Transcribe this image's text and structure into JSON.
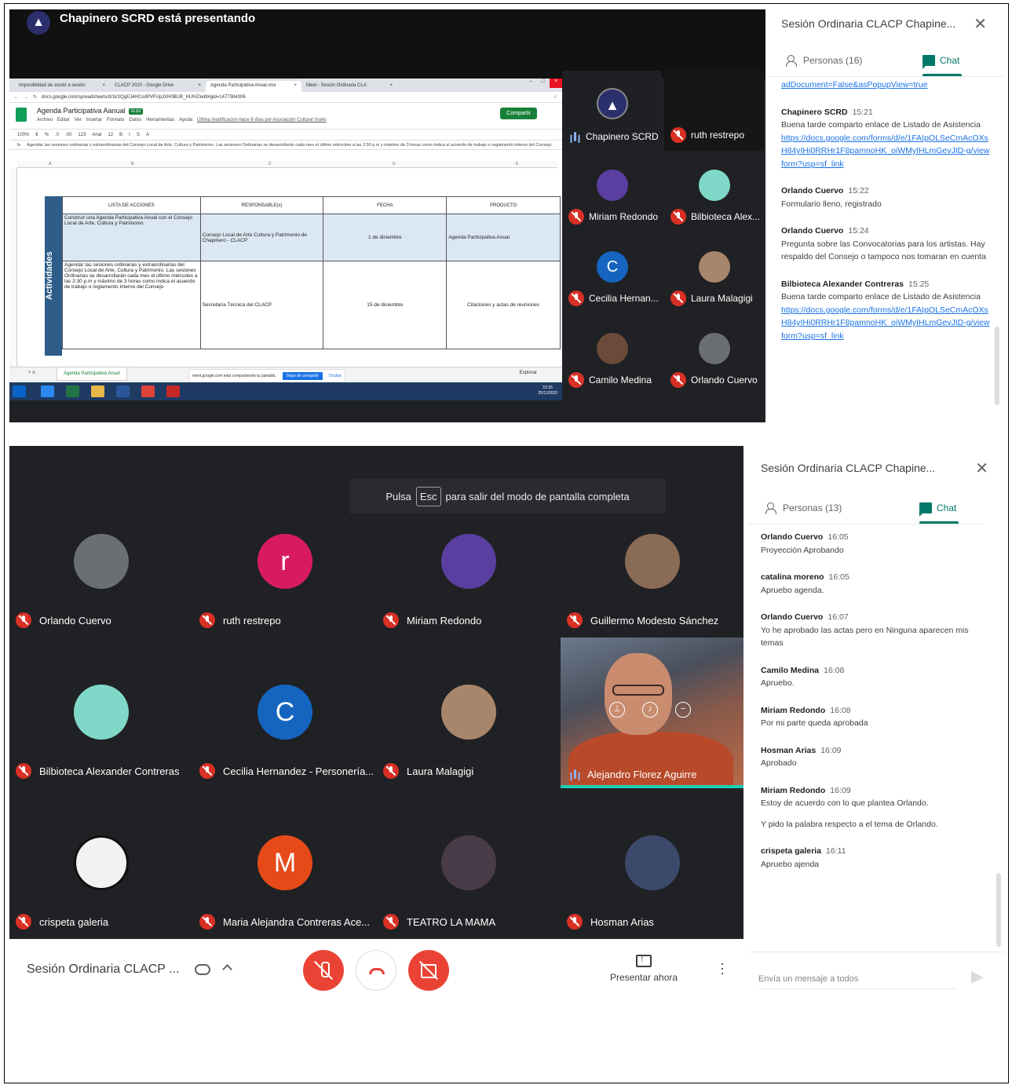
{
  "top": {
    "presenting_label": "Chapinero SCRD está presentando",
    "browser": {
      "tabs": [
        "Imposibilidad de asistir a sesión",
        "CLACP 2020 - Google Drive",
        "Agenda Participativa Anual.xlsx",
        "Meet - Sesión Ordinaria CLA"
      ],
      "url": "docs.google.com/spreadsheets/d/1kSQgEJ4HCodPVFUpJXH0BUB_HUHZ/edit#gid=1477384306"
    },
    "sheet": {
      "title": "Agenda Participativa Aanual",
      "badge": "XLSX",
      "menus": [
        "Archivo",
        "Editar",
        "Ver",
        "Insertar",
        "Formato",
        "Datos",
        "Herramientas",
        "Ayuda"
      ],
      "last_edit": "Última modificación hace 8 días por Asociación Cultural Vuelo",
      "share_label": "Compartir",
      "toolbar": [
        "100%",
        "€",
        "%",
        ".0",
        ".00",
        "123",
        "Arial",
        "12",
        "B",
        "I",
        "S",
        "A"
      ],
      "formula": "Agendar las sesiones ordinarias y extraordinarias del Consejo Local de Arte, Cultura y Patrimonio. Las sesiones Ordinarias se desarrollarán cada mes el último miércoles a las 2:30 p.m y máximo de 3 horas como indica el acuerdo de trabajo o reglamento interno del Consejo",
      "columns": [
        "A",
        "B",
        "C",
        "D",
        "E"
      ],
      "side_label": "Actividades",
      "headers": [
        "LISTA DE ACCIONES",
        "RESPONSABLE(s)",
        "FECHA",
        "PRODUCTO"
      ],
      "rows": [
        [
          "Construir una Agenda Participativa Anual con el Consejo Local de Arte, Cultura y Patrimonio",
          "Consejo Local de Arte Cultura y Patrimonio de Chapinero - CLACP",
          "1 de diciembre",
          "Agenda Participativa Anual"
        ],
        [
          "Agendar las sesiones ordinarias y extraordinarias del Consejo Local de Arte, Cultura y Patrimonio. Las sesiones Ordinarias se desarrollarán cada mes el último miércoles a las 2:30 p.m y máximo de 3 horas como indica el acuerdo de trabajo o reglamento interno del Consejo",
          "Secretaría Técnica del CLACP",
          "15 de diciembre",
          "Citaciones y actas de reuniones"
        ]
      ],
      "sheet_tab": "Agenda Participativa Anual",
      "share_notice": "meet.google.com está compartiendo tu pantalla.",
      "stop_share": "Dejar de compartir",
      "hide": "Ocultar",
      "explore": "Explorar",
      "clock": "15:25",
      "date": "25/11/2020"
    },
    "participants": [
      {
        "name": "Chapinero SCRD",
        "speaking": true
      },
      {
        "name": "ruth restrepo",
        "speaking": false
      },
      {
        "name": "Miriam Redondo",
        "speaking": false
      },
      {
        "name": "Bilbioteca Alex...",
        "speaking": false
      },
      {
        "name": "Cecilia Hernan...",
        "speaking": false,
        "letter": "C"
      },
      {
        "name": "Laura Malagigi",
        "speaking": false
      },
      {
        "name": "Camilo Medina",
        "speaking": false
      },
      {
        "name": "Orlando Cuervo",
        "speaking": false
      }
    ],
    "chat": {
      "title": "Sesión Ordinaria CLACP Chapine...",
      "people_tab": "Personas (16)",
      "chat_tab": "Chat",
      "first_link": "adDocument=False&asPopupView=true",
      "messages": [
        {
          "author": "Chapinero SCRD",
          "time": "15:21",
          "text": "Buena tarde comparto enlace de Listado de Asistencia",
          "link": "https://docs.google.com/forms/d/e/1FAIpQLSeCmAcOXsH84yIHi0RRHr1F8pamnoHK_oiWMyIHLmGevJID-g/viewform?usp=sf_link"
        },
        {
          "author": "Orlando Cuervo",
          "time": "15:22",
          "text": "Formulario lleno, registrado",
          "link": ""
        },
        {
          "author": "Orlando Cuervo",
          "time": "15:24",
          "text": "Pregunta sobre las Convocatorias para los artistas. Hay respaldo del Consejo o tampoco nos tomaran en cuenta",
          "link": ""
        },
        {
          "author": "Bilbioteca Alexander Contreras",
          "time": "15:25",
          "text": "Buena tarde comparto enlace de Listado de Asistencia",
          "link": "https://docs.google.com/forms/d/e/1FAIpQLSeCmAcOXsH84yIHi0RRHr1F8pamnoHK_oiWMyIHLmGevJID-g/viewform?usp=sf_link"
        }
      ]
    }
  },
  "bottom": {
    "esc_prefix": "Pulsa",
    "esc_key": "Esc",
    "esc_suffix": "para salir del modo de pantalla completa",
    "participants": [
      {
        "name": "Orlando Cuervo",
        "letter": "",
        "color": "#6b6e73"
      },
      {
        "name": "ruth restrepo",
        "letter": "r",
        "color": "#d81b60"
      },
      {
        "name": "Miriam Redondo",
        "letter": "",
        "color": "#5a3fa0"
      },
      {
        "name": "Guillermo Modesto Sánchez",
        "letter": "",
        "color": "#8a6b55"
      },
      {
        "name": "Bilbioteca Alexander Contreras",
        "letter": "",
        "color": "#7fd8c8"
      },
      {
        "name": "Cecilia Hernandez - Personería...",
        "letter": "C",
        "color": "#1565c0"
      },
      {
        "name": "Laura Malagigi",
        "letter": "",
        "color": "#a8866b"
      },
      {
        "name": "crispeta galeria",
        "letter": "",
        "color": "#f2f2f2"
      },
      {
        "name": "Maria Alejandra Contreras Ace...",
        "letter": "M",
        "color": "#e64a19"
      },
      {
        "name": "TEATRO LA MAMA",
        "letter": "",
        "color": "#4a3b48"
      },
      {
        "name": "Hosman Arias",
        "letter": "",
        "color": "#3b4a6b"
      }
    ],
    "video_participant": "Alejandro Florez Aguirre",
    "controls": {
      "meeting_name": "Sesión Ordinaria CLACP ...",
      "present_label": "Presentar ahora"
    },
    "chat": {
      "title": "Sesión Ordinaria CLACP Chapine...",
      "people_tab": "Personas (13)",
      "chat_tab": "Chat",
      "messages": [
        {
          "author": "Orlando Cuervo",
          "time": "16:05",
          "text": "Proyección Aprobando"
        },
        {
          "author": "catalina moreno",
          "time": "16:05",
          "text": "Apruebo agenda."
        },
        {
          "author": "Orlando Cuervo",
          "time": "16:07",
          "text": "Yo he aprobado las actas pero en Ninguna aparecen mis temas"
        },
        {
          "author": "Camilo Medina",
          "time": "16:08",
          "text": "Apruebo."
        },
        {
          "author": "Miriam Redondo",
          "time": "16:08",
          "text": "Por mi parte queda aprobada"
        },
        {
          "author": "Hosman Arias",
          "time": "16:09",
          "text": "Aprobado"
        },
        {
          "author": "Miriam Redondo",
          "time": "16:09",
          "text": "Estoy de acuerdo con lo que plantea Orlando.",
          "extra": "Y pido la palabra respecto a el tema de Orlando."
        },
        {
          "author": "crispeta galeria",
          "time": "16:11",
          "text": "Apruebo ajenda"
        }
      ],
      "input_placeholder": "Envía un mensaje a todos"
    }
  }
}
